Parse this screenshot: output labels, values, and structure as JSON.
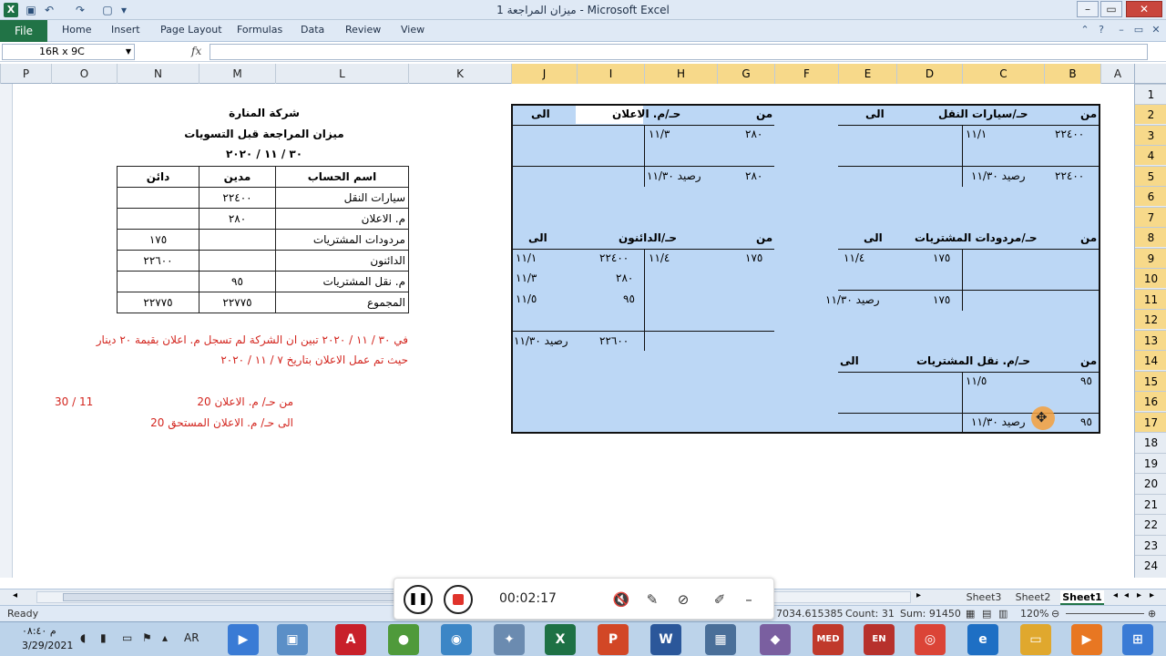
{
  "window": {
    "title": "ميزان المراجعة 1 - Microsoft Excel",
    "app_logo": "X"
  },
  "ribbon": {
    "file": "File",
    "tabs": [
      "Home",
      "Insert",
      "Page Layout",
      "Formulas",
      "Data",
      "Review",
      "View"
    ]
  },
  "formula_bar": {
    "name_box": "16R x 9C",
    "fx": "fx",
    "value": ""
  },
  "columns": [
    "P",
    "O",
    "N",
    "M",
    "L",
    "K",
    "J",
    "I",
    "H",
    "G",
    "F",
    "E",
    "D",
    "C",
    "B",
    "A"
  ],
  "rows": [
    "1",
    "2",
    "3",
    "4",
    "5",
    "6",
    "7",
    "8",
    "9",
    "10",
    "11",
    "12",
    "13",
    "14",
    "15",
    "16",
    "17",
    "18",
    "19",
    "20",
    "21",
    "22",
    "23",
    "24"
  ],
  "trial_balance": {
    "company": "شركة المنارة",
    "title": "ميزان المراجعة قبل التسويات",
    "date": "٣٠ / ١١ / ٢٠٢٠",
    "headers": {
      "account": "اسم الحساب",
      "debit": "مدين",
      "credit": "دائن"
    },
    "rows": [
      {
        "account": "سيارات النقل",
        "debit": "٢٢٤٠٠",
        "credit": ""
      },
      {
        "account": "م. الاعلان",
        "debit": "٢٨٠",
        "credit": ""
      },
      {
        "account": "مردودات المشتريات",
        "debit": "",
        "credit": "١٧٥"
      },
      {
        "account": "الدائنون",
        "debit": "",
        "credit": "٢٢٦٠٠"
      },
      {
        "account": "م. نقل المشتريات",
        "debit": "٩٥",
        "credit": ""
      },
      {
        "account": "المجموع",
        "debit": "٢٢٧٧٥",
        "credit": "٢٢٧٧٥"
      }
    ]
  },
  "note": {
    "line1": "في ٣٠ / ١١ / ٢٠٢٠ تبين ان الشركة لم تسجل م. اعلان بقيمة ٢٠ دينار",
    "line2": "حيث تم عمل الاعلان بتاريخ ٧ / ١١ / ٢٠٢٠",
    "entry_date": "30 / 11",
    "entry_line1": "20 من حـ/ م. الاعلان",
    "entry_line2": "20 الى  حـ/ م. الاعلان المستحق"
  },
  "t_accounts": {
    "from": "من",
    "to": "الى",
    "balance": "رصيد ١١/٣٠",
    "transport_cars": {
      "title": "حـ/سيارات النقل",
      "debit_amount": "٢٢٤٠٠",
      "debit_date": "١١/١",
      "balance_amount": "٢٢٤٠٠"
    },
    "advertising": {
      "title": "حـ/م. الاعلان",
      "debit_amount": "٢٨٠",
      "debit_date": "١١/٣",
      "balance_amount": "٢٨٠"
    },
    "purchase_returns": {
      "title": "حـ/مردودات المشتريات",
      "credit_amount": "١٧٥",
      "credit_date": "١١/٤",
      "balance_amount": "١٧٥"
    },
    "creditors": {
      "title": "حـ/الدائنون",
      "debit_amount": "١٧٥",
      "debit_date": "١١/٤",
      "credit": [
        {
          "amount": "٢٢٤٠٠",
          "date": "١١/١"
        },
        {
          "amount": "٢٨٠",
          "date": "١١/٣"
        },
        {
          "amount": "٩٥",
          "date": "١١/٥"
        }
      ],
      "balance_amount": "٢٢٦٠٠"
    },
    "purchase_freight": {
      "title": "حـ/م. نقل المشتريات",
      "debit_amount": "٩٥",
      "debit_date": "١١/٥",
      "balance_amount": "٩٥"
    }
  },
  "sheet_tabs": [
    "Sheet3",
    "Sheet2",
    "Sheet1"
  ],
  "status_bar": {
    "ready": "Ready",
    "average": "7034.615385",
    "count": "Count: 31",
    "sum": "Sum: 91450",
    "zoom": "120%"
  },
  "recorder": {
    "time": "00:02:17"
  },
  "taskbar": {
    "time": "م ٠٨:٤٠",
    "date": "3/29/2021",
    "lang": "AR",
    "apps": [
      "X",
      "P",
      "W",
      "MED",
      "EN"
    ]
  }
}
